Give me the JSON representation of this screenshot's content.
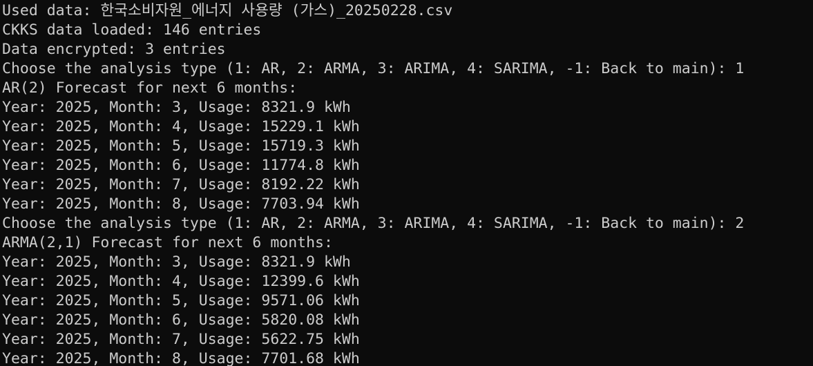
{
  "terminal": {
    "lines": [
      "Used data: 한국소비자원_에너지 사용량 (가스)_20250228.csv",
      "CKKS data loaded: 146 entries",
      "Data encrypted: 3 entries",
      "Choose the analysis type (1: AR, 2: ARMA, 3: ARIMA, 4: SARIMA, -1: Back to main): 1",
      "AR(2) Forecast for next 6 months:",
      "Year: 2025, Month: 3, Usage: 8321.9 kWh",
      "Year: 2025, Month: 4, Usage: 15229.1 kWh",
      "Year: 2025, Month: 5, Usage: 15719.3 kWh",
      "Year: 2025, Month: 6, Usage: 11774.8 kWh",
      "Year: 2025, Month: 7, Usage: 8192.22 kWh",
      "Year: 2025, Month: 8, Usage: 7703.94 kWh",
      "Choose the analysis type (1: AR, 2: ARMA, 3: ARIMA, 4: SARIMA, -1: Back to main): 2",
      "ARMA(2,1) Forecast for next 6 months:",
      "Year: 2025, Month: 3, Usage: 8321.9 kWh",
      "Year: 2025, Month: 4, Usage: 12399.6 kWh",
      "Year: 2025, Month: 5, Usage: 9571.06 kWh",
      "Year: 2025, Month: 6, Usage: 5820.08 kWh",
      "Year: 2025, Month: 7, Usage: 5622.75 kWh",
      "Year: 2025, Month: 8, Usage: 7701.68 kWh"
    ]
  },
  "colors": {
    "background": "#0c0c0c",
    "foreground": "#cccccc"
  }
}
